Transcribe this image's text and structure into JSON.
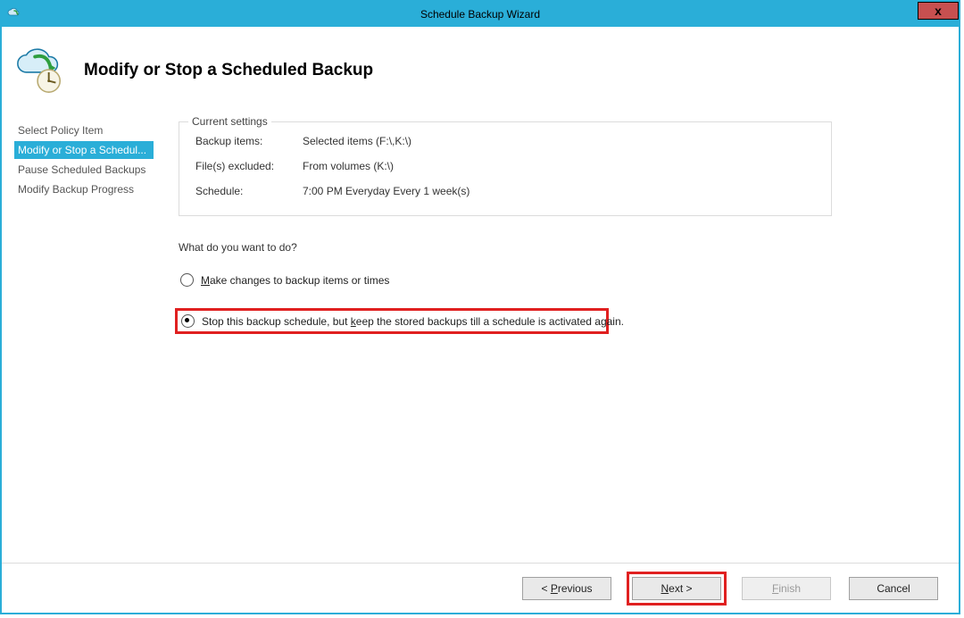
{
  "window": {
    "title": "Schedule Backup Wizard",
    "close_glyph": "x"
  },
  "header": {
    "page_title": "Modify or Stop a Scheduled Backup"
  },
  "sidebar": {
    "items": [
      {
        "label": "Select Policy Item",
        "selected": false
      },
      {
        "label": "Modify or Stop a Schedul...",
        "selected": true
      },
      {
        "label": "Pause Scheduled Backups",
        "selected": false
      },
      {
        "label": "Modify Backup Progress",
        "selected": false
      }
    ]
  },
  "current_settings": {
    "legend": "Current settings",
    "rows": [
      {
        "label": "Backup items:",
        "value": "Selected items (F:\\,K:\\)"
      },
      {
        "label": "File(s) excluded:",
        "value": "From volumes (K:\\)"
      },
      {
        "label": "Schedule:",
        "value": "7:00 PM Everyday Every 1 week(s)"
      }
    ]
  },
  "question": "What do you want to do?",
  "options": {
    "opt1": {
      "pre": "",
      "hot": "M",
      "post": "ake changes to backup items or times",
      "checked": false
    },
    "opt2": {
      "pre": "Stop this backup schedule, but ",
      "hot": "k",
      "post": "eep the stored backups till a schedule is activated again.",
      "checked": true
    }
  },
  "buttons": {
    "previous": {
      "pre": "< ",
      "hot": "P",
      "post": "revious"
    },
    "next": {
      "pre": "",
      "hot": "N",
      "post": "ext >"
    },
    "finish": {
      "pre": "",
      "hot": "F",
      "post": "inish"
    },
    "cancel": {
      "label": "Cancel"
    }
  }
}
